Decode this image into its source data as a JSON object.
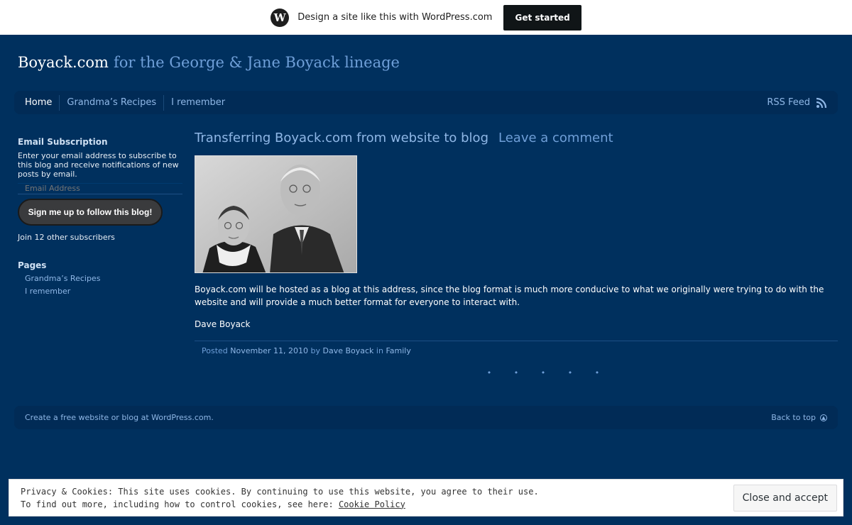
{
  "wpbar": {
    "logo_glyph": "W",
    "promo": "Design a site like this with WordPress.com",
    "cta": "Get started"
  },
  "header": {
    "title": "Boyack.com",
    "description": "for the George & Jane Boyack lineage"
  },
  "nav": {
    "items": [
      {
        "label": "Home"
      },
      {
        "label": "Grandma’s Recipes"
      },
      {
        "label": "I remember"
      }
    ],
    "rss_label": "RSS Feed"
  },
  "sidebar": {
    "email_title": "Email Subscription",
    "email_text": "Enter your email address to subscribe to this blog and receive notifications of new posts by email.",
    "email_placeholder": "Email Address",
    "follow_button": "Sign me up to follow this blog!",
    "subscribers": "Join 12 other subscribers",
    "pages_title": "Pages",
    "pages": [
      {
        "label": "Grandma’s Recipes"
      },
      {
        "label": "I remember"
      }
    ]
  },
  "post": {
    "title": "Transferring Boyack.com from website to blog",
    "comment_link": "Leave a comment",
    "body": "Boyack.com will be hosted as a blog at this address, since the blog format is much more conducive to what we originally were trying to do with the website and will provide a much better format for everyone to interact with.",
    "signature": "Dave Boyack",
    "meta": {
      "posted": "Posted",
      "date": "November 11, 2010",
      "by": "by",
      "author": "Dave Boyack",
      "in": "in",
      "category": "Family"
    },
    "dots": "• • • • •"
  },
  "footer": {
    "credit": "Create a free website or blog at WordPress.com.",
    "back_to_top": "Back to top"
  },
  "cookie": {
    "line1": "Privacy & Cookies: This site uses cookies. By continuing to use this website, you agree to their use.",
    "line2_prefix": "To find out more, including how to control cookies, see here:",
    "policy_link": "Cookie Policy",
    "close_button": "Close and accept"
  },
  "colors": {
    "background": "#00305e",
    "nav_bg": "#012b56",
    "link": "#8fb7e6",
    "accent": "#6f9fd8"
  }
}
